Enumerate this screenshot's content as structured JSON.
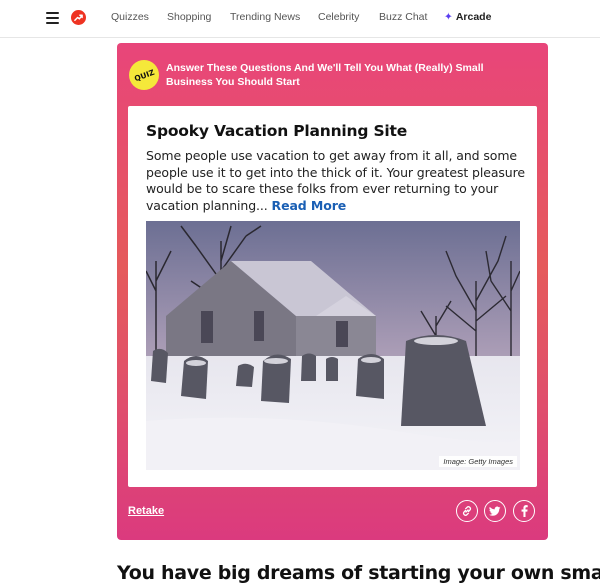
{
  "nav": {
    "links": [
      "Quizzes",
      "Shopping",
      "Trending News",
      "Celebrity",
      "Buzz Chat"
    ],
    "arcade": "Arcade",
    "arcade_icon": "sparkle-icon"
  },
  "quiz": {
    "badge": "QUIZ",
    "title": "Answer These Questions And We'll Tell You What (Really) Small Business You Should Start",
    "card_colors": [
      "#e8457a",
      "#e55a5b",
      "#db3a7e"
    ],
    "result": {
      "title": "Spooky Vacation Planning Site",
      "description": "Some people use vacation to get away from it all, and some people use it to get into the thick of it. Your greatest pleasure would be to scare these folks from ever returning to your vacation planning...",
      "read_more": "Read More",
      "image_credit": "Image: Getty Images"
    },
    "retake": "Retake",
    "share": [
      "link-icon",
      "twitter-icon",
      "facebook-icon"
    ]
  },
  "article": {
    "heading": "You have big dreams of starting your own small"
  }
}
